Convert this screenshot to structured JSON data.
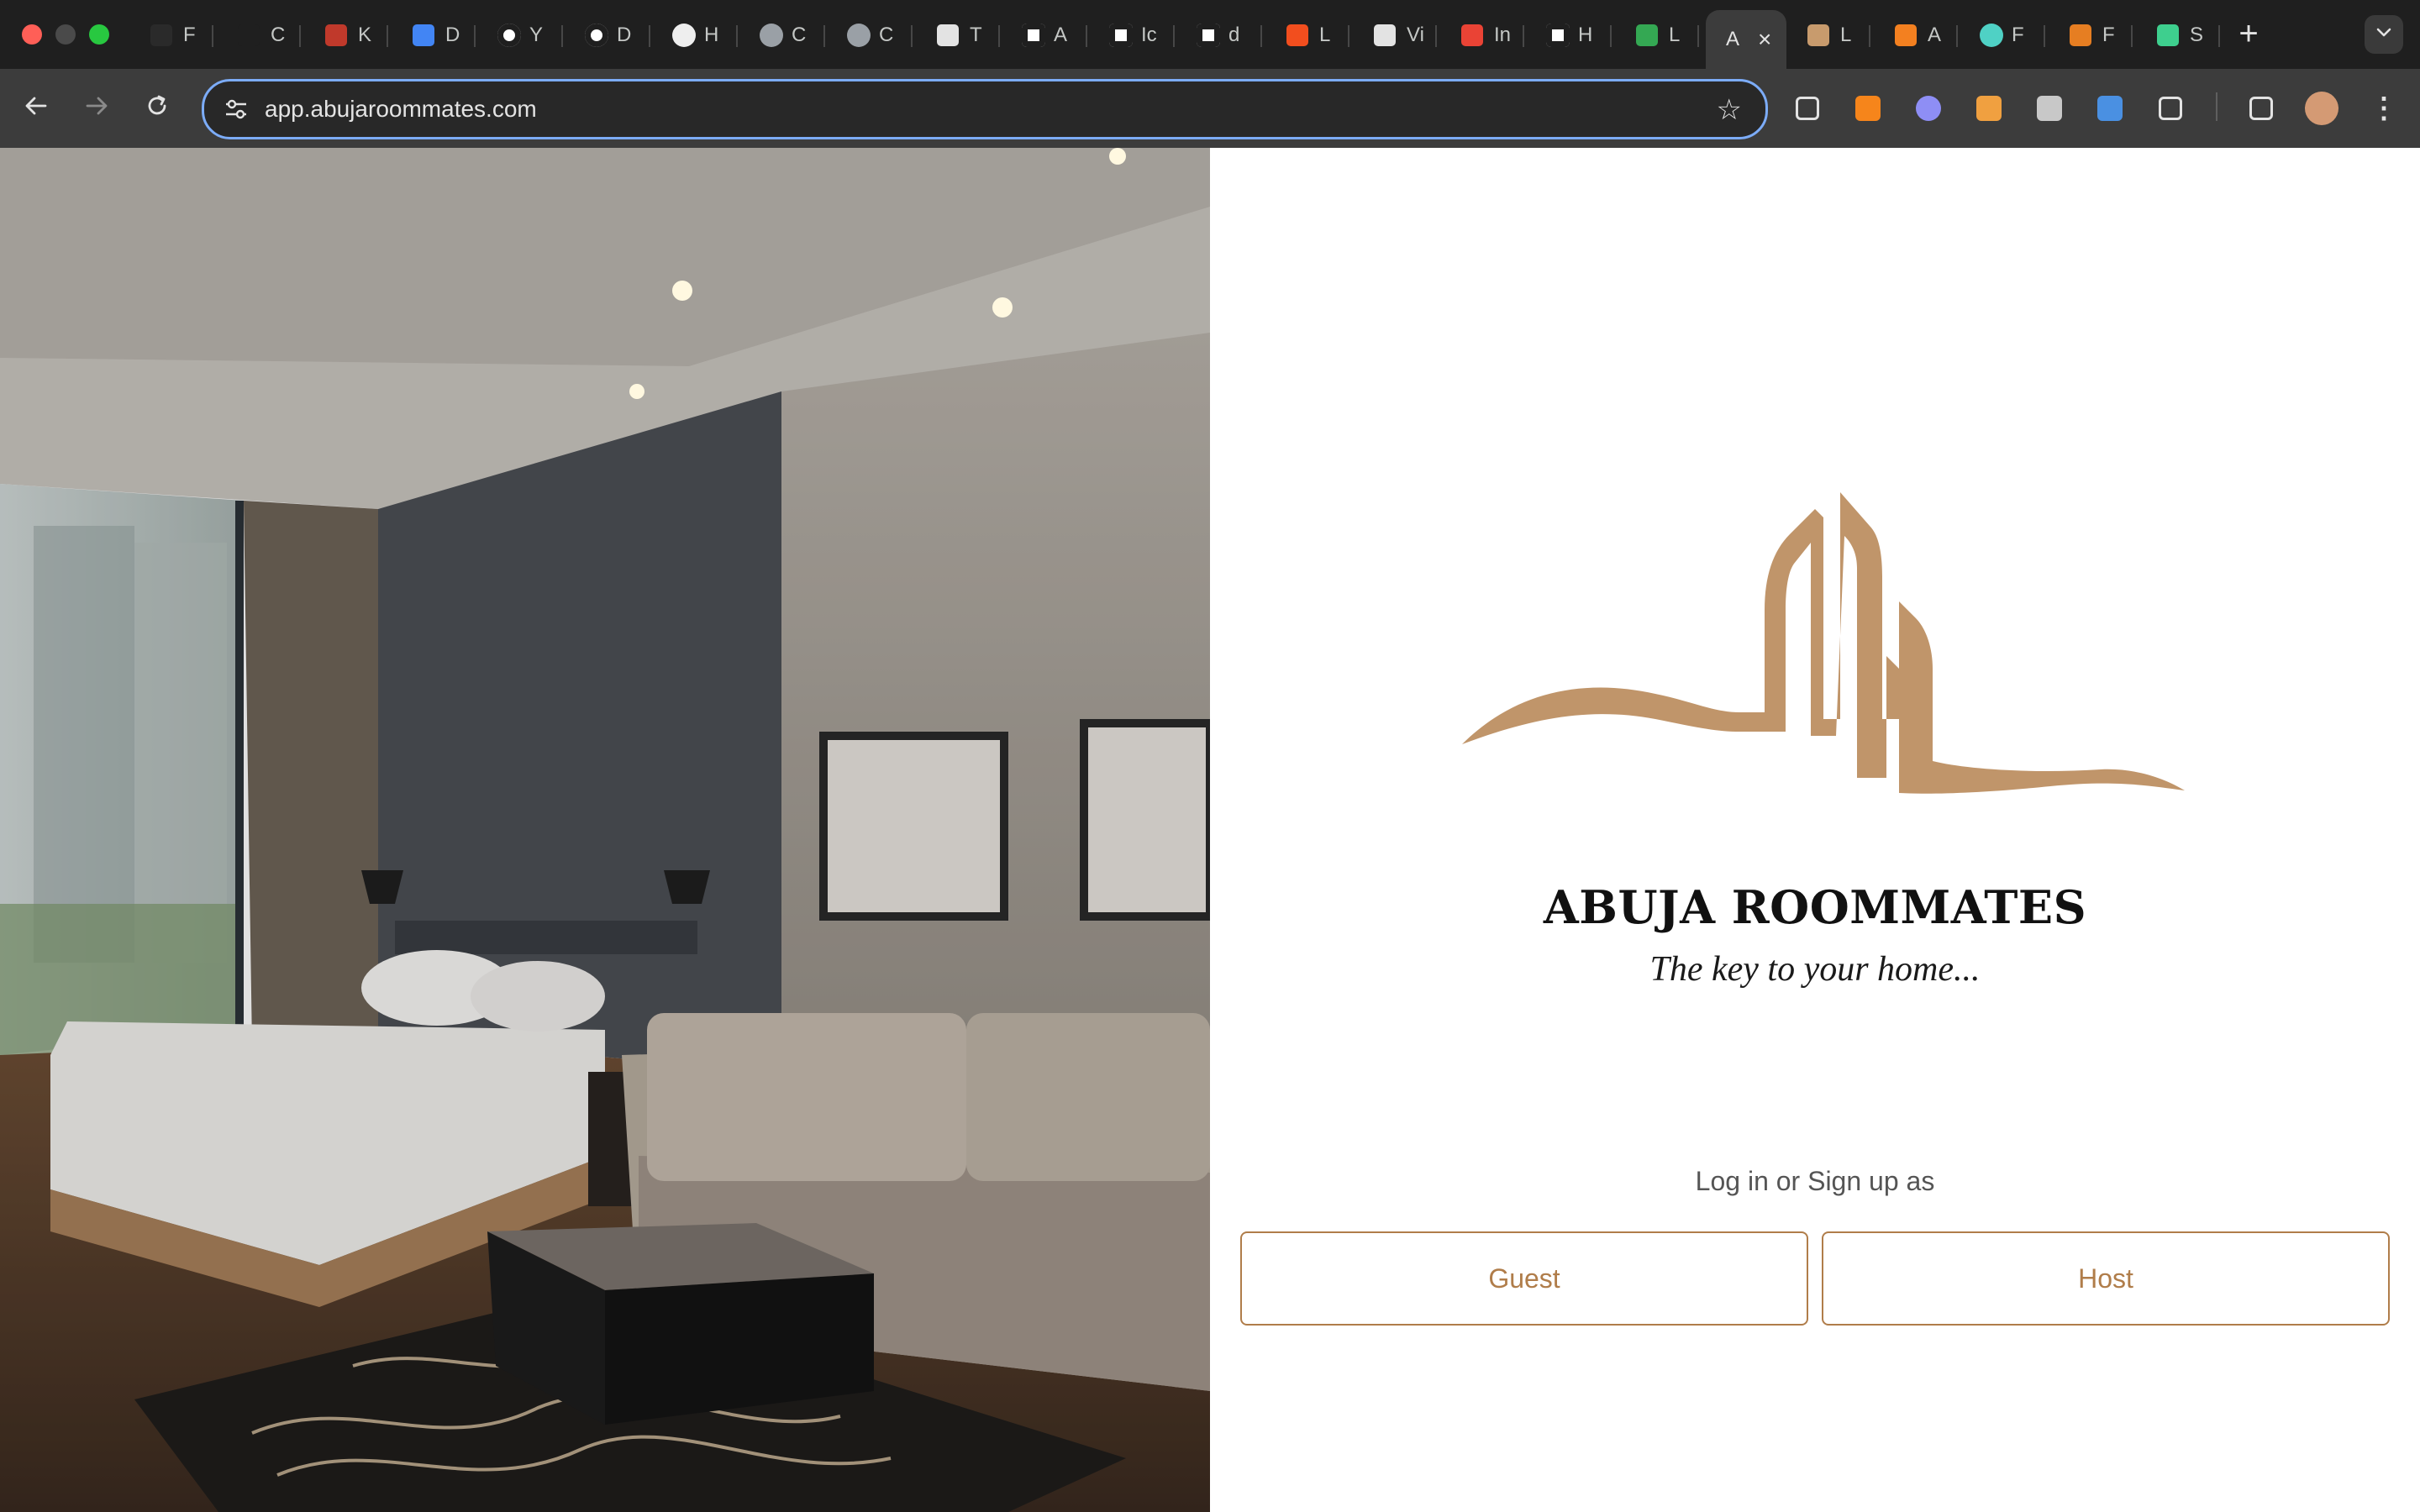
{
  "browser": {
    "tabs": [
      {
        "title": "F",
        "icon": "openai-icon",
        "color": "#2a2a2a"
      },
      {
        "title": "C",
        "icon": "ol-icon",
        "color": "#1f1f1f"
      },
      {
        "title": "K",
        "icon": "mug-icon",
        "color": "#c0392b"
      },
      {
        "title": "D",
        "icon": "docs-icon",
        "color": "#4285f4"
      },
      {
        "title": "Y",
        "icon": "github-icon",
        "color": "#ffffff"
      },
      {
        "title": "D",
        "icon": "github-icon",
        "color": "#ffffff"
      },
      {
        "title": "H",
        "icon": "egg-icon",
        "color": "#eeeeee"
      },
      {
        "title": "C",
        "icon": "globe-icon",
        "color": "#9aa0a6"
      },
      {
        "title": "C",
        "icon": "globe-icon",
        "color": "#9aa0a6"
      },
      {
        "title": "T",
        "icon": "book-icon",
        "color": "#e3e3e3"
      },
      {
        "title": "A",
        "icon": "vb-icon",
        "color": "#ffffff"
      },
      {
        "title": "Ic",
        "icon": "mail-icon",
        "color": "#ffffff"
      },
      {
        "title": "d",
        "icon": "doc-icon",
        "color": "#ffffff"
      },
      {
        "title": "L",
        "icon": "figma-icon",
        "color": "#f24e1e"
      },
      {
        "title": "Vi",
        "icon": "speaker-icon",
        "color": "#e3e3e3"
      },
      {
        "title": "In",
        "icon": "gmail-icon",
        "color": "#ea4335"
      },
      {
        "title": "H",
        "icon": "x-icon",
        "color": "#ffffff"
      },
      {
        "title": "L",
        "icon": "play-icon",
        "color": "#34a853"
      },
      {
        "title": "A",
        "icon": "abuja-icon",
        "color": "#e3e3e3",
        "active": true
      },
      {
        "title": "L",
        "icon": "small-logo-icon",
        "color": "#c89b6d"
      },
      {
        "title": "A",
        "icon": "cloud-icon",
        "color": "#f38020"
      },
      {
        "title": "F",
        "icon": "circle-icon",
        "color": "#4fd1c5"
      },
      {
        "title": "F",
        "icon": "hand-icon",
        "color": "#e67e22"
      },
      {
        "title": "S",
        "icon": "bolt-icon",
        "color": "#3ecf8e"
      }
    ],
    "new_tab_label": "+",
    "url": "app.abujaroommates.com",
    "extensions": [
      "eyedropper-icon",
      "metamask-icon",
      "ghost-icon",
      "pen-icon",
      "drive-icon",
      "gem-icon",
      "puzzle-icon",
      "media-icon",
      "profile-avatar"
    ]
  },
  "page": {
    "brand_title": "ABUJA ROOMMATES",
    "tagline": "The key to your home...",
    "prompt": "Log in or Sign up as",
    "guest_button": "Guest",
    "host_button": "Host",
    "accent_color": "#b07d4a",
    "logo_color": "#c0956a"
  }
}
